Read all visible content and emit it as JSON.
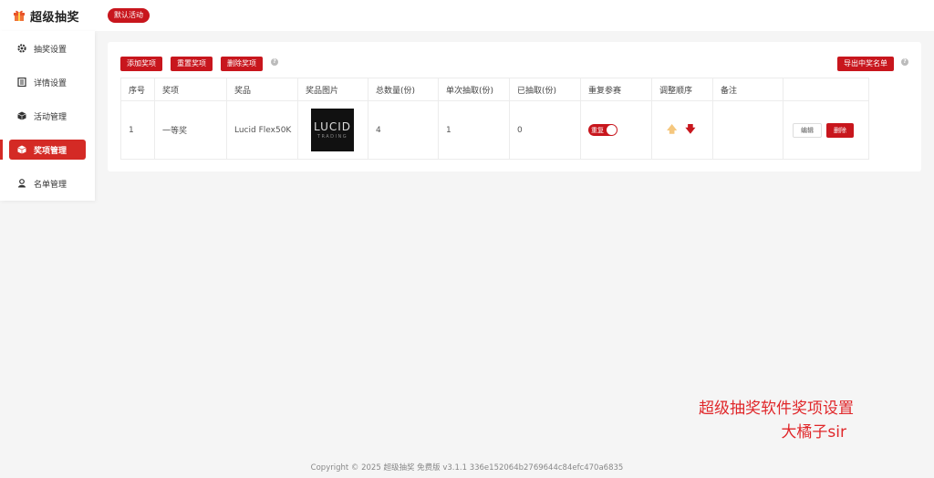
{
  "header": {
    "app_title": "超级抽奖",
    "activity_pill": "默认活动"
  },
  "sidebar": {
    "items": [
      {
        "label": "抽奖设置",
        "icon": "gear-icon"
      },
      {
        "label": "详情设置",
        "icon": "list-icon"
      },
      {
        "label": "活动管理",
        "icon": "box-icon"
      },
      {
        "label": "奖项管理",
        "icon": "prize-box-icon",
        "active": true
      },
      {
        "label": "名单管理",
        "icon": "user-icon"
      }
    ]
  },
  "toolbar": {
    "add_label": "添加奖项",
    "reset_label": "重置奖项",
    "delete_label": "删除奖项",
    "export_label": "导出中奖名单",
    "help_glyph": "?"
  },
  "table": {
    "columns": [
      "序号",
      "奖项",
      "奖品",
      "奖品图片",
      "总数量(份)",
      "单次抽取(份)",
      "已抽取(份)",
      "重复参赛",
      "调整顺序",
      "备注",
      ""
    ],
    "rows": [
      {
        "index": "1",
        "level": "一等奖",
        "prize": "Lucid Flex50K",
        "image_text_1": "LUCID",
        "image_text_2": "TRADING",
        "total": "4",
        "per_draw": "1",
        "drawn": "0",
        "repeat_label": "重复",
        "repeat_on": true,
        "note": "",
        "edit_label": "编辑",
        "delete_label": "删除"
      }
    ]
  },
  "overlay": {
    "line1": "超级抽奖软件奖项设置",
    "line2": "大橘子sir"
  },
  "footer": {
    "text": "Copyright © 2025   超级抽奖   免费版   v3.1.1   336e152064b2769644c84efc470a6835"
  },
  "colors": {
    "brand_red": "#c8161d",
    "active_red": "#d42a25",
    "overlay_red": "#e0272a",
    "arrow_up": "#f5c77e",
    "arrow_down": "#c8161d"
  }
}
